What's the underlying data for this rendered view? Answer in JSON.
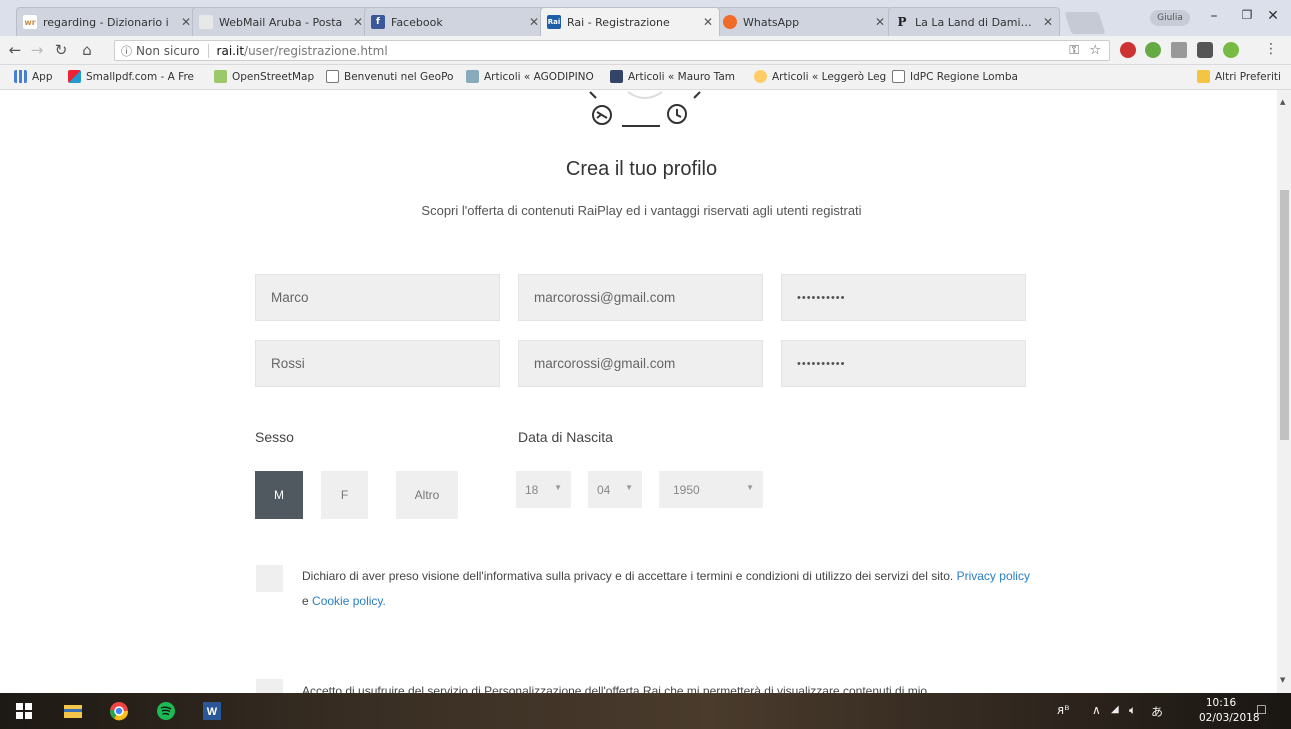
{
  "browser": {
    "tabs": [
      {
        "label": "regarding - Dizionario i",
        "favicon": "wr-icon",
        "active": false
      },
      {
        "label": "WebMail Aruba - Posta",
        "favicon": "webmail-icon",
        "active": false
      },
      {
        "label": "Facebook",
        "favicon": "facebook-icon",
        "active": false
      },
      {
        "label": "Rai - Registrazione",
        "favicon": "rai-icon",
        "active": true
      },
      {
        "label": "WhatsApp",
        "favicon": "whatsapp-icon",
        "active": false
      },
      {
        "label": "La La Land di Damien C",
        "favicon": "p-icon",
        "active": false
      }
    ],
    "profile_label": "Giulia",
    "security_label": "Non sicuro",
    "url_host": "rai.it",
    "url_path": "/user/registrazione.html",
    "bookmarks": [
      {
        "label": "App",
        "icon": "apps-icon"
      },
      {
        "label": "Smallpdf.com - A Fre",
        "icon": "smallpdf-icon"
      },
      {
        "label": "OpenStreetMap",
        "icon": "osm-icon"
      },
      {
        "label": "Benvenuti nel GeoPo",
        "icon": "page-icon"
      },
      {
        "label": "Articoli « AGODIPINO",
        "icon": "agodipino-icon"
      },
      {
        "label": "Articoli « Mauro Tam",
        "icon": "mauro-icon"
      },
      {
        "label": "Articoli « Leggerò Leg",
        "icon": "leggero-icon"
      },
      {
        "label": "IdPC Regione Lomba",
        "icon": "page-icon"
      }
    ],
    "other_bookmarks": "Altri Preferiti"
  },
  "page": {
    "title": "Crea il tuo profilo",
    "subtitle": "Scopri l'offerta di contenuti RaiPlay ed i vantaggi riservati agli utenti registrati",
    "fields": {
      "first_name": "Marco",
      "last_name": "Rossi",
      "email": "marcorossi@gmail.com",
      "email_confirm": "marcorossi@gmail.com",
      "password": "••••••••••",
      "password_confirm": "••••••••••"
    },
    "gender_label": "Sesso",
    "gender_options": [
      "M",
      "F",
      "Altro"
    ],
    "gender_selected": "M",
    "birth_label": "Data di Nascita",
    "birth_day": "18",
    "birth_month": "04",
    "birth_year": "1950",
    "privacy_text": "Dichiaro di aver preso visione dell'informativa sulla privacy e di accettare i termini e condizioni di utilizzo dei servizi del sito.",
    "privacy_link": "Privacy policy",
    "privacy_and": "e",
    "cookie_link": "Cookie policy.",
    "personalization_text": "Accetto di usufruire del servizio di Personalizzazione dell'offerta Rai che mi permetterà di visualizzare contenuti di mio"
  },
  "taskbar": {
    "time": "10:16",
    "date": "02/03/2018"
  },
  "colors": {
    "selected_gender": "#515960",
    "field_bg": "#efefef",
    "link": "#2a7fc4"
  }
}
